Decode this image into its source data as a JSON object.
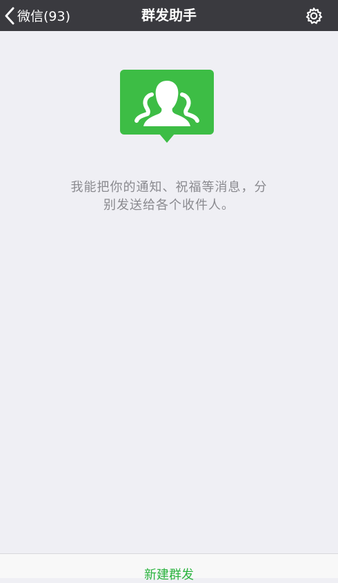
{
  "nav": {
    "back_label": "微信(93)",
    "title": "群发助手",
    "settings_icon": "gear-icon"
  },
  "main": {
    "hero_icon": "group-chat-icon",
    "description": "我能把你的通知、祝福等消息，分别发送给各个收件人。"
  },
  "bottom": {
    "new_broadcast_label": "新建群发"
  },
  "colors": {
    "nav_bg": "#3a3a3f",
    "page_bg": "#efeff4",
    "accent_green": "#3dbd45",
    "button_text_green": "#2bb33f",
    "description_text": "#8a8a8f"
  }
}
